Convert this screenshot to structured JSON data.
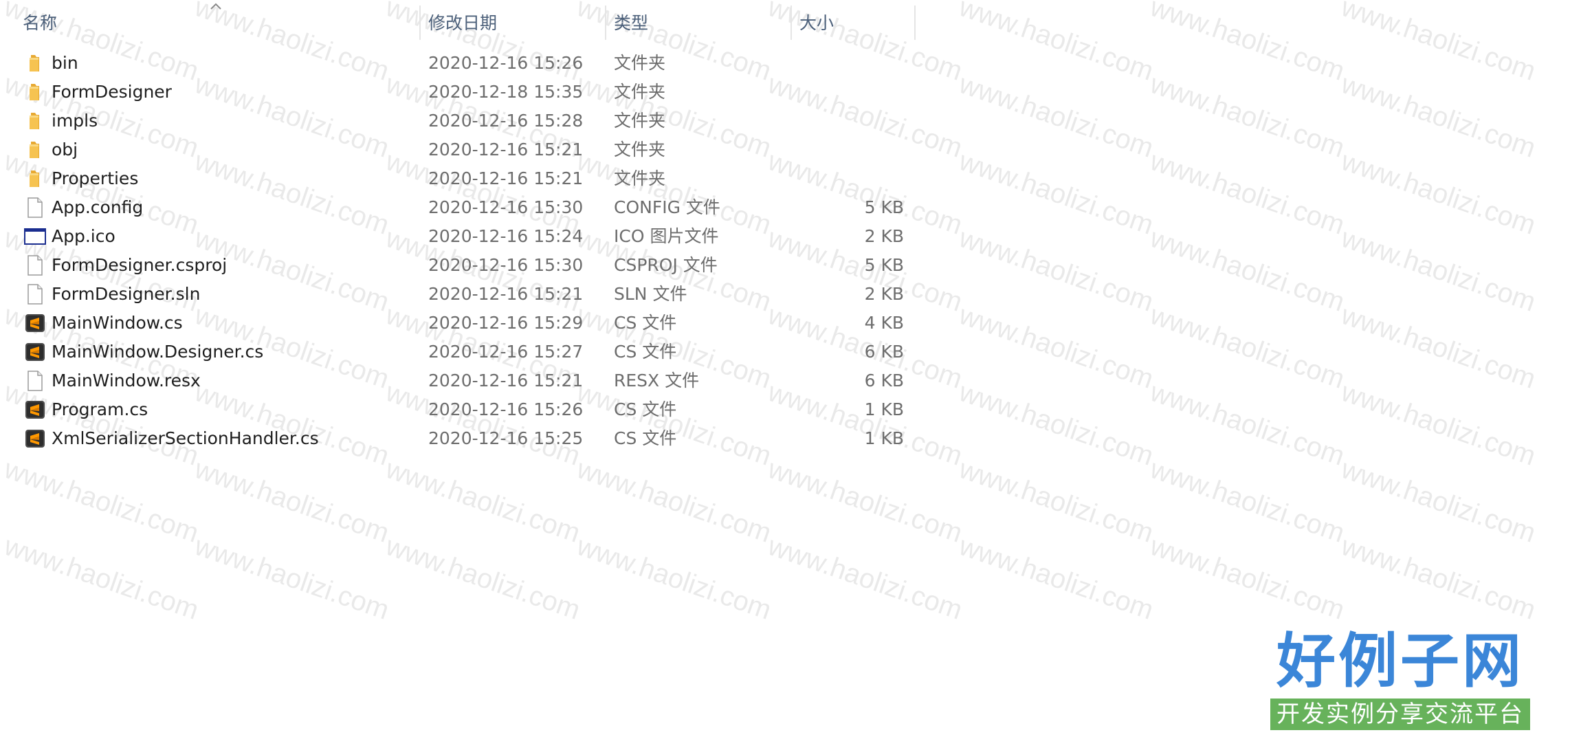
{
  "columns": {
    "name": "名称",
    "modified": "修改日期",
    "type": "类型",
    "size": "大小"
  },
  "files": [
    {
      "name": "bin",
      "modified": "2020-12-16 15:26",
      "type": "文件夹",
      "size": "",
      "icon": "folder-icon"
    },
    {
      "name": "FormDesigner",
      "modified": "2020-12-18 15:35",
      "type": "文件夹",
      "size": "",
      "icon": "folder-icon"
    },
    {
      "name": "impls",
      "modified": "2020-12-16 15:28",
      "type": "文件夹",
      "size": "",
      "icon": "folder-icon"
    },
    {
      "name": "obj",
      "modified": "2020-12-16 15:21",
      "type": "文件夹",
      "size": "",
      "icon": "folder-icon"
    },
    {
      "name": "Properties",
      "modified": "2020-12-16 15:21",
      "type": "文件夹",
      "size": "",
      "icon": "folder-icon"
    },
    {
      "name": "App.config",
      "modified": "2020-12-16 15:30",
      "type": "CONFIG 文件",
      "size": "5 KB",
      "icon": "document-icon"
    },
    {
      "name": "App.ico",
      "modified": "2020-12-16 15:24",
      "type": "ICO 图片文件",
      "size": "2 KB",
      "icon": "window-icon"
    },
    {
      "name": "FormDesigner.csproj",
      "modified": "2020-12-16 15:30",
      "type": "CSPROJ 文件",
      "size": "5 KB",
      "icon": "document-icon"
    },
    {
      "name": "FormDesigner.sln",
      "modified": "2020-12-16 15:21",
      "type": "SLN 文件",
      "size": "2 KB",
      "icon": "document-icon"
    },
    {
      "name": "MainWindow.cs",
      "modified": "2020-12-16 15:29",
      "type": "CS 文件",
      "size": "4 KB",
      "icon": "sublime-text-icon"
    },
    {
      "name": "MainWindow.Designer.cs",
      "modified": "2020-12-16 15:27",
      "type": "CS 文件",
      "size": "6 KB",
      "icon": "sublime-text-icon"
    },
    {
      "name": "MainWindow.resx",
      "modified": "2020-12-16 15:21",
      "type": "RESX 文件",
      "size": "6 KB",
      "icon": "document-icon"
    },
    {
      "name": "Program.cs",
      "modified": "2020-12-16 15:26",
      "type": "CS 文件",
      "size": "1 KB",
      "icon": "sublime-text-icon"
    },
    {
      "name": "XmlSerializerSectionHandler.cs",
      "modified": "2020-12-16 15:25",
      "type": "CS 文件",
      "size": "1 KB",
      "icon": "sublime-text-icon"
    }
  ],
  "watermark": {
    "text": "www.haolizi.com"
  },
  "logo": {
    "title": "好例子网",
    "subtitle": "开发实例分享交流平台"
  },
  "colors": {
    "header_text": "#4c607a",
    "name_text": "#1e1e1e",
    "detail_text": "#6d6d6d",
    "logo_blue": "#3b86d8",
    "logo_green": "#67b25b",
    "folder": "#f6c351"
  }
}
